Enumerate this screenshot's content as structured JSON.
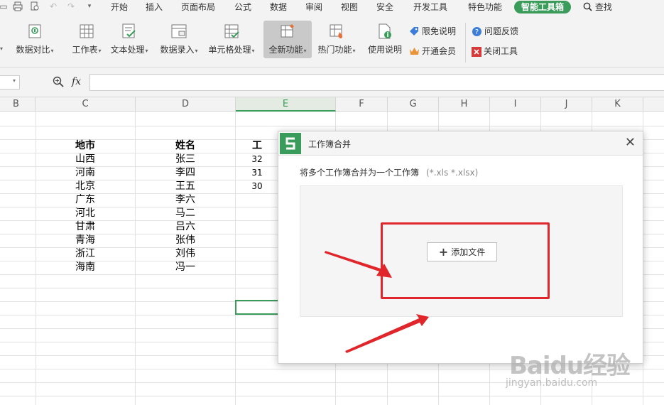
{
  "menu": {
    "tabs": [
      "开始",
      "插入",
      "页面布局",
      "公式",
      "数据",
      "审阅",
      "视图",
      "安全",
      "开发工具",
      "特色功能",
      "智能工具箱"
    ],
    "active_tab": "智能工具箱",
    "search_label": "查找"
  },
  "ribbon": {
    "buttons": [
      {
        "label": "数据对比",
        "icon": "data-compare-icon"
      },
      {
        "label": "工作表",
        "icon": "worksheet-icon"
      },
      {
        "label": "文本处理",
        "icon": "text-process-icon"
      },
      {
        "label": "数据录入",
        "icon": "data-entry-icon"
      },
      {
        "label": "单元格处理",
        "icon": "cell-process-icon"
      },
      {
        "label": "全新功能",
        "icon": "new-feature-icon",
        "selected": true
      },
      {
        "label": "热门功能",
        "icon": "hot-feature-icon"
      },
      {
        "label": "使用说明",
        "icon": "manual-icon"
      }
    ],
    "small": {
      "free_notice": "限免说明",
      "open_member": "开通会员",
      "feedback": "问题反馈",
      "close_tool": "关闭工具"
    }
  },
  "formula_bar": {
    "fx_label": "fx",
    "value": ""
  },
  "sheet": {
    "columns": [
      "B",
      "C",
      "D",
      "E",
      "F",
      "G",
      "H",
      "I",
      "J",
      "K"
    ],
    "active_column": "E",
    "headers": {
      "city": "地市",
      "name": "姓名",
      "partial": "工"
    },
    "rows": [
      {
        "city": "山西",
        "name": "张三",
        "e": "32"
      },
      {
        "city": "河南",
        "name": "李四",
        "e": "31"
      },
      {
        "city": "北京",
        "name": "王五",
        "e": "30"
      },
      {
        "city": "广东",
        "name": "李六",
        "e": ""
      },
      {
        "city": "河北",
        "name": "马二",
        "e": ""
      },
      {
        "city": "甘肃",
        "name": "吕六",
        "e": ""
      },
      {
        "city": "青海",
        "name": "张伟",
        "e": ""
      },
      {
        "city": "浙江",
        "name": "刘伟",
        "e": ""
      },
      {
        "city": "海南",
        "name": "冯一",
        "e": ""
      }
    ]
  },
  "dialog": {
    "title": "工作簿合并",
    "description": "将多个工作簿合并为一个工作簿",
    "extensions": "(*.xls *.xlsx)",
    "add_button": "添加文件",
    "close_glyph": "✕"
  },
  "colors": {
    "accent": "#3a9c5b",
    "annotation_red": "#e0262b"
  },
  "watermark": {
    "main": "Bai&#x5ea6;经验",
    "text": "Baidu经验",
    "sub": "jingyan.baidu.com"
  }
}
